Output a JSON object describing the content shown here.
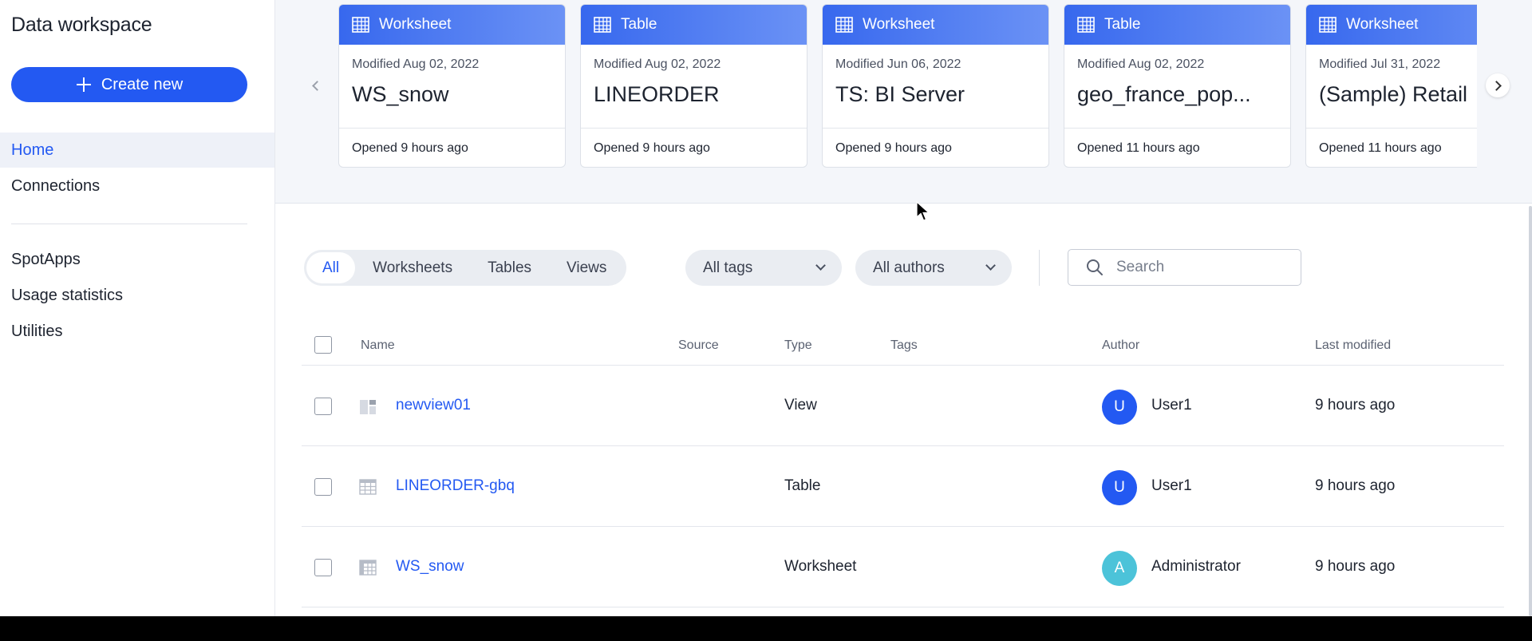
{
  "sidebar": {
    "title": "Data workspace",
    "create_label": "Create new",
    "nav": [
      {
        "label": "Home",
        "active": true
      },
      {
        "label": "Connections"
      },
      {
        "label": "SpotApps"
      },
      {
        "label": "Usage statistics"
      },
      {
        "label": "Utilities"
      }
    ]
  },
  "recents": {
    "cards": [
      {
        "kind": "Worksheet",
        "modified": "Modified Aug 02, 2022",
        "name": "WS_snow",
        "opened": "Opened 9 hours ago"
      },
      {
        "kind": "Table",
        "modified": "Modified Aug 02, 2022",
        "name": "LINEORDER",
        "opened": "Opened 9 hours ago"
      },
      {
        "kind": "Worksheet",
        "modified": "Modified Jun 06, 2022",
        "name": "TS: BI Server",
        "opened": "Opened 9 hours ago"
      },
      {
        "kind": "Table",
        "modified": "Modified Aug 02, 2022",
        "name": "geo_france_pop...",
        "opened": "Opened 11 hours ago"
      },
      {
        "kind": "Worksheet",
        "modified": "Modified Jul 31, 2022",
        "name": "(Sample) Retail",
        "opened": "Opened 11 hours ago"
      }
    ]
  },
  "filters": {
    "segments": [
      "All",
      "Worksheets",
      "Tables",
      "Views"
    ],
    "active_segment": "All",
    "tags_label": "All tags",
    "authors_label": "All authors",
    "search_placeholder": "Search"
  },
  "table": {
    "headers": {
      "name": "Name",
      "source": "Source",
      "type": "Type",
      "tags": "Tags",
      "author": "Author",
      "modified": "Last modified"
    },
    "rows": [
      {
        "name": "newview01",
        "type": "View",
        "icon": "view-icon",
        "author_initial": "U",
        "author": "User1",
        "modified": "9 hours ago"
      },
      {
        "name": "LINEORDER-gbq",
        "type": "Table",
        "icon": "table-icon",
        "author_initial": "U",
        "author": "User1",
        "modified": "9 hours ago"
      },
      {
        "name": "WS_snow",
        "type": "Worksheet",
        "icon": "worksheet-icon",
        "author_initial": "A",
        "author": "Administrator",
        "modified": "9 hours ago"
      }
    ]
  },
  "colors": {
    "primary": "#2359f2",
    "avatar_user": "#2359f2",
    "avatar_admin": "#4cc3d9",
    "card_header": "#3768ee"
  }
}
